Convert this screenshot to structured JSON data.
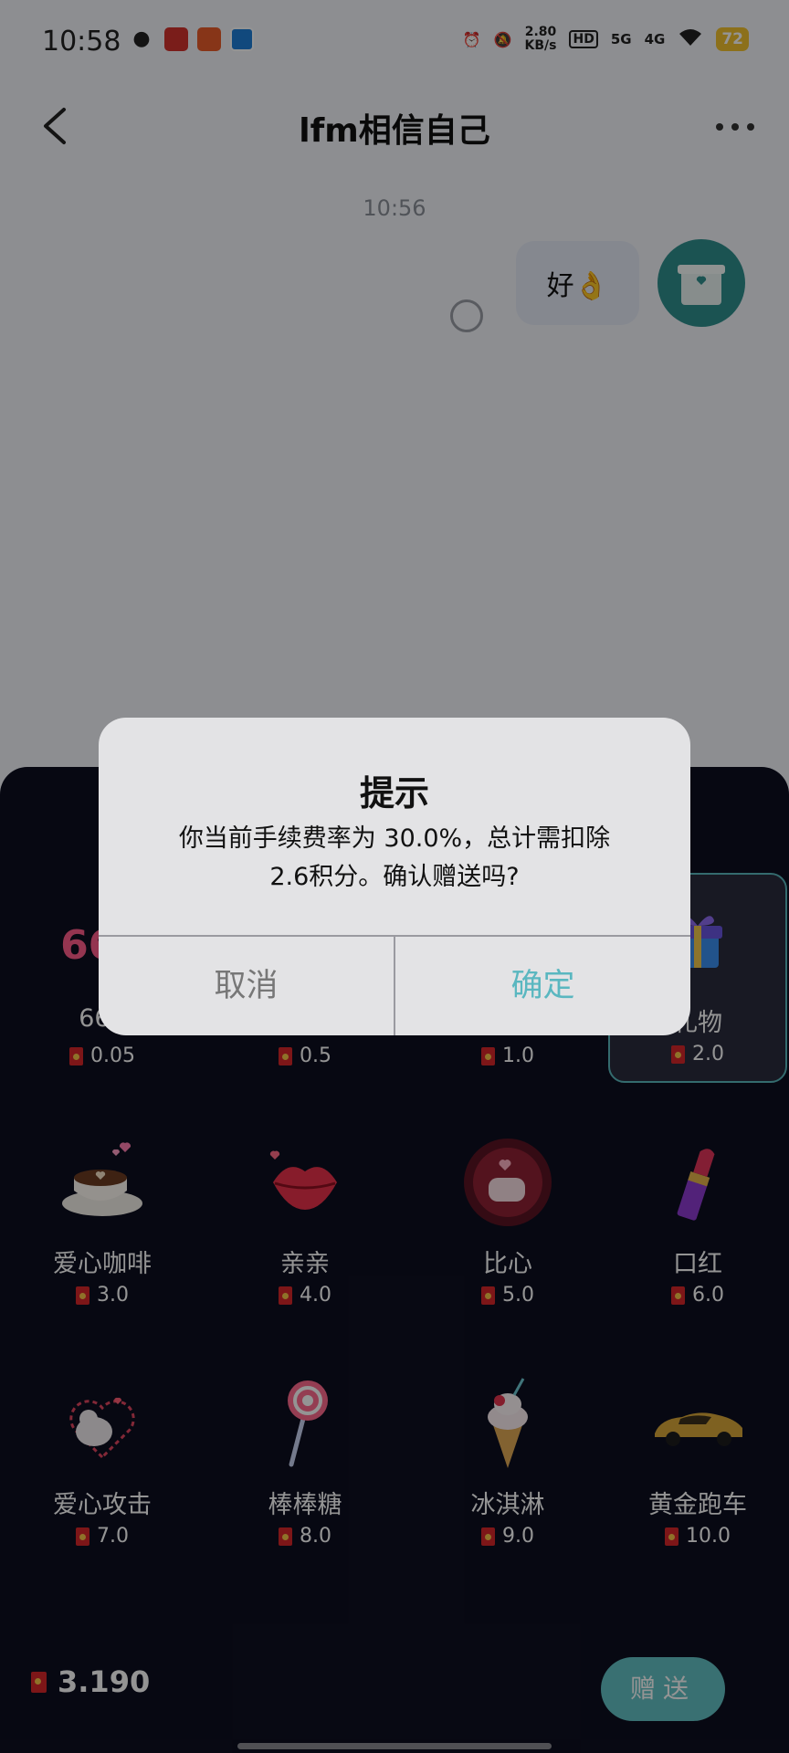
{
  "status_bar": {
    "time": "10:58",
    "speed_value": "2.80",
    "speed_unit": "KB/s",
    "hd_label": "HD",
    "net1": "5G",
    "net2": "4G",
    "battery": "72"
  },
  "nav": {
    "title": "lfm相信自己"
  },
  "chat": {
    "timestamp": "10:56",
    "message_text": "好👌"
  },
  "gifts": [
    {
      "name": "666",
      "price": "0.05",
      "icon": "666-icon"
    },
    {
      "name": "",
      "price": "0.5",
      "icon": "gift-icon"
    },
    {
      "name": "",
      "price": "1.0",
      "icon": "gift-icon"
    },
    {
      "name": "礼物",
      "price": "2.0",
      "icon": "gift-box-icon",
      "selected": true
    },
    {
      "name": "爱心咖啡",
      "price": "3.0",
      "icon": "heart-coffee-icon"
    },
    {
      "name": "亲亲",
      "price": "4.0",
      "icon": "kiss-lips-icon"
    },
    {
      "name": "比心",
      "price": "5.0",
      "icon": "finger-heart-icon"
    },
    {
      "name": "口红",
      "price": "6.0",
      "icon": "lipstick-icon"
    },
    {
      "name": "爱心攻击",
      "price": "7.0",
      "icon": "heart-attack-icon"
    },
    {
      "name": "棒棒糖",
      "price": "8.0",
      "icon": "lollipop-icon"
    },
    {
      "name": "冰淇淋",
      "price": "9.0",
      "icon": "ice-cream-icon"
    },
    {
      "name": "黄金跑车",
      "price": "10.0",
      "icon": "gold-sports-car-icon"
    }
  ],
  "balance": "3.190",
  "send_label": "赠送",
  "dialog": {
    "title": "提示",
    "message_line1": "你当前手续费率为 30.0%，总计需扣除",
    "message_line2": "2.6积分。确认赠送吗?",
    "cancel_label": "取消",
    "confirm_label": "确定"
  },
  "colors": {
    "accent": "#5ab7c0",
    "panel_bg": "#0d0f20",
    "bubble_bg": "#e6ebf7",
    "avatar_bg": "#2f8f8e"
  }
}
